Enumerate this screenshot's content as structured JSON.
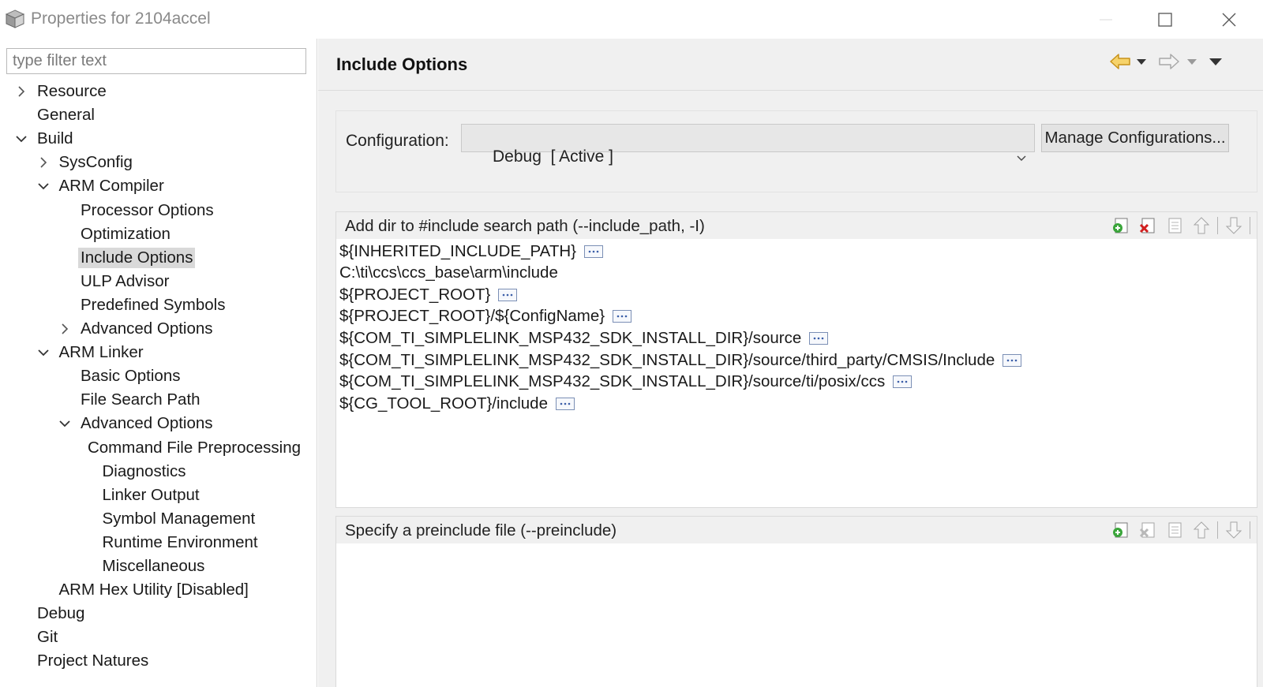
{
  "window": {
    "title": "Properties for 2104accel",
    "icons": {
      "app": "cube-icon",
      "minimize": "minimize-icon",
      "maximize": "maximize-icon",
      "close": "close-icon"
    }
  },
  "filter": {
    "placeholder": "type filter text",
    "value": ""
  },
  "tree": [
    {
      "label": "Resource",
      "expander": "collapsed"
    },
    {
      "label": "General",
      "expander": "none"
    },
    {
      "label": "Build",
      "expander": "expanded"
    },
    {
      "label": "SysConfig",
      "expander": "collapsed"
    },
    {
      "label": "ARM Compiler",
      "expander": "expanded"
    },
    {
      "label": "Processor Options",
      "expander": "none"
    },
    {
      "label": "Optimization",
      "expander": "none"
    },
    {
      "label": "Include Options",
      "expander": "none",
      "selected": true
    },
    {
      "label": "ULP Advisor",
      "expander": "none"
    },
    {
      "label": "Predefined Symbols",
      "expander": "none"
    },
    {
      "label": "Advanced Options",
      "expander": "collapsed"
    },
    {
      "label": "ARM Linker",
      "expander": "expanded"
    },
    {
      "label": "Basic Options",
      "expander": "none"
    },
    {
      "label": "File Search Path",
      "expander": "none"
    },
    {
      "label": "Advanced Options",
      "expander": "expanded"
    },
    {
      "label": "Command File Preprocessing",
      "expander": "none"
    },
    {
      "label": "Diagnostics",
      "expander": "none"
    },
    {
      "label": "Linker Output",
      "expander": "none"
    },
    {
      "label": "Symbol Management",
      "expander": "none"
    },
    {
      "label": "Runtime Environment",
      "expander": "none"
    },
    {
      "label": "Miscellaneous",
      "expander": "none"
    },
    {
      "label": "ARM Hex Utility  [Disabled]",
      "expander": "none"
    },
    {
      "label": "Debug",
      "expander": "none"
    },
    {
      "label": "Git",
      "expander": "none"
    },
    {
      "label": "Project Natures",
      "expander": "none"
    }
  ],
  "page": {
    "title": "Include Options",
    "nav": {
      "back": "back-arrow-icon",
      "forward": "forward-arrow-icon",
      "menu": "view-menu-icon"
    }
  },
  "configuration": {
    "label": "Configuration:",
    "selected": "Debug  [ Active ]",
    "manage_label": "Manage Configurations..."
  },
  "include_paths": {
    "title": "Add dir to #include search path (--include_path, -I)",
    "items": [
      {
        "text": "${INHERITED_INCLUDE_PATH}",
        "has_edit": true
      },
      {
        "text": "C:\\ti\\ccs\\ccs_base\\arm\\include",
        "has_edit": false
      },
      {
        "text": "${PROJECT_ROOT}",
        "has_edit": true
      },
      {
        "text": "${PROJECT_ROOT}/${ConfigName}",
        "has_edit": true
      },
      {
        "text": "${COM_TI_SIMPLELINK_MSP432_SDK_INSTALL_DIR}/source",
        "has_edit": true
      },
      {
        "text": "${COM_TI_SIMPLELINK_MSP432_SDK_INSTALL_DIR}/source/third_party/CMSIS/Include",
        "has_edit": true
      },
      {
        "text": "${COM_TI_SIMPLELINK_MSP432_SDK_INSTALL_DIR}/source/ti/posix/ccs",
        "has_edit": true
      },
      {
        "text": "${CG_TOOL_ROOT}/include",
        "has_edit": true
      }
    ],
    "tools": [
      "add-icon",
      "delete-icon",
      "edit-icon",
      "move-up-icon",
      "move-down-icon"
    ]
  },
  "preinclude": {
    "title": "Specify a preinclude file (--preinclude)",
    "items": [],
    "tools": [
      "add-icon",
      "delete-icon",
      "edit-icon",
      "move-up-icon",
      "move-down-icon"
    ]
  }
}
